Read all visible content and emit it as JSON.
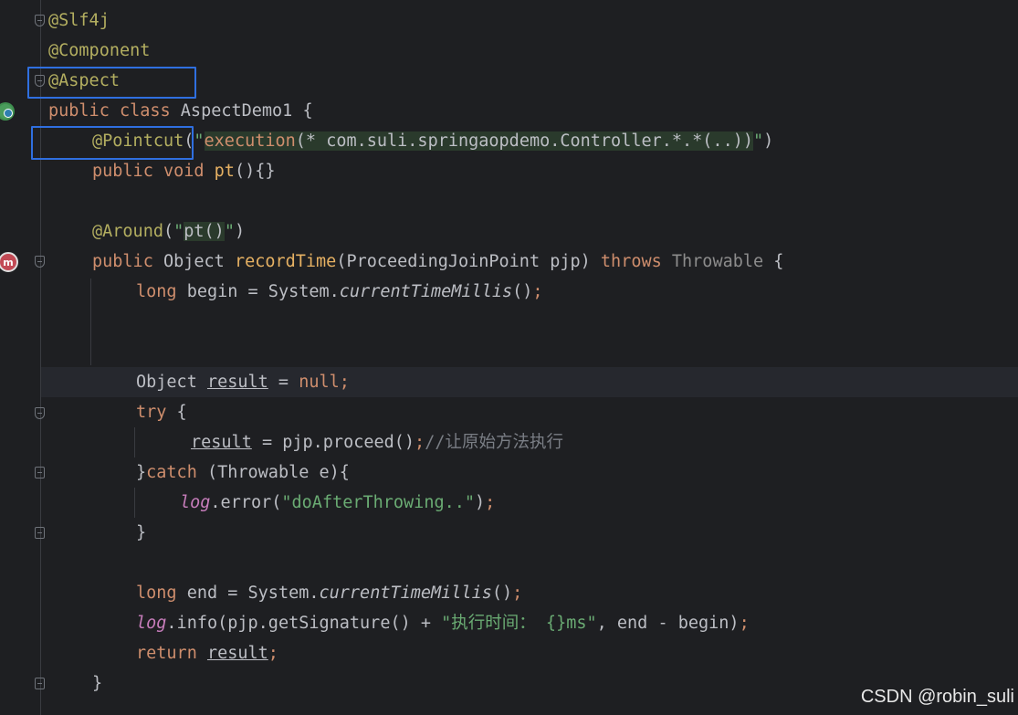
{
  "editor": {
    "lines": {
      "l1": "@Slf4j",
      "l2": "@Component",
      "l3": "@Aspect",
      "l4_kw": "public class ",
      "l4_name": "AspectDemo1 {",
      "l5_ann": "@Pointcut",
      "l5_open": "(",
      "l5_q1": "\"",
      "l5_exec": "execution",
      "l5_body": "(* com.suli.springaopdemo.Controller.*.*(..))",
      "l5_q2": "\"",
      "l5_close": ")",
      "l6_kw": "public void ",
      "l6_name": "pt",
      "l6_rest": "(){}",
      "l8_ann": "@Around",
      "l8_open": "(",
      "l8_q1": "\"",
      "l8_str": "pt()",
      "l8_q2": "\"",
      "l8_close": ")",
      "l9_kw": "public ",
      "l9_type": "Object ",
      "l9_name": "recordTime",
      "l9_params": "(ProceedingJoinPoint pjp) ",
      "l9_throws": "throws ",
      "l9_thr": "Throwable",
      "l9_end": " {",
      "l10_kw": "long ",
      "l10_var": "begin = System.",
      "l10_call": "currentTimeMillis",
      "l10_end": "()",
      "l10_semi": ";",
      "l13_type": "Object ",
      "l13_var": "result",
      "l13_eq": " = ",
      "l13_null": "null",
      "l13_semi": ";",
      "l14_kw": "try",
      "l14_brace": " {",
      "l15_var": "result",
      "l15_rest": " = pjp.proceed()",
      "l15_semi": ";",
      "l15_cm": "//让原始方法执行",
      "l16_close": "}",
      "l16_kw": "catch",
      "l16_rest": " (Throwable e){",
      "l17_log": "log",
      "l17_rest": ".error(",
      "l17_str": "\"doAfterThrowing..\"",
      "l17_end": ")",
      "l17_semi": ";",
      "l18": "}",
      "l20_kw": "long ",
      "l20_var": "end = System.",
      "l20_call": "currentTimeMillis",
      "l20_end": "()",
      "l20_semi": ";",
      "l21_log": "log",
      "l21_rest": ".info(pjp.getSignature() + ",
      "l21_str": "\"执行时间： {}ms\"",
      "l21_rest2": ", end - begin)",
      "l21_semi": ";",
      "l22_kw": "return ",
      "l22_var": "result",
      "l22_semi": ";",
      "l23": "}"
    }
  },
  "gutter": {
    "aspect_icon": "aspect-icon",
    "method_icon": "m",
    "method_icon_name": "method-icon"
  },
  "watermark": "CSDN @robin_suli",
  "colors": {
    "highlight_box": "#2f6fe0",
    "background": "#1e1f22",
    "keyword": "#cf8e6d",
    "annotation": "#b3ae60",
    "string": "#6aab73"
  }
}
